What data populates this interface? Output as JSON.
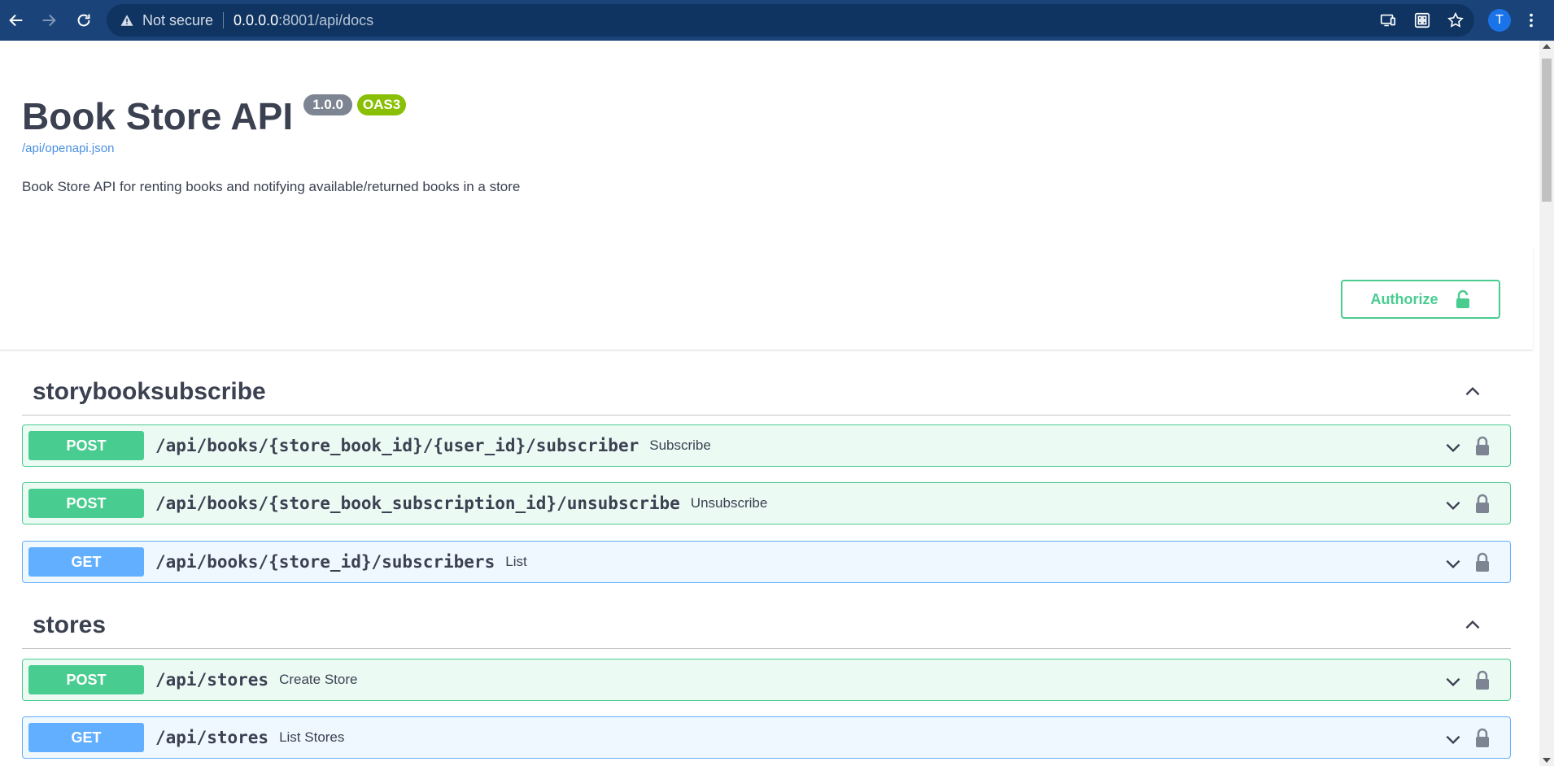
{
  "browser": {
    "not_secure": "Not secure",
    "url_host": "0.0.0.0",
    "url_rest": ":8001/api/docs",
    "profile_initial": "T"
  },
  "info": {
    "title": "Book Store API",
    "version": "1.0.0",
    "oas": "OAS3",
    "spec_link": "/api/openapi.json",
    "description": "Book Store API for renting books and notifying available/returned books in a store"
  },
  "authorize_label": "Authorize",
  "tags": [
    {
      "name": "storybooksubscribe",
      "operations": [
        {
          "method": "POST",
          "path": "/api/books/{store_book_id}/{user_id}/subscriber",
          "summary": "Subscribe"
        },
        {
          "method": "POST",
          "path": "/api/books/{store_book_subscription_id}/unsubscribe",
          "summary": "Unsubscribe"
        },
        {
          "method": "GET",
          "path": "/api/books/{store_id}/subscribers",
          "summary": "List"
        }
      ]
    },
    {
      "name": "stores",
      "operations": [
        {
          "method": "POST",
          "path": "/api/stores",
          "summary": "Create Store"
        },
        {
          "method": "GET",
          "path": "/api/stores",
          "summary": "List Stores"
        }
      ]
    }
  ],
  "colors": {
    "post": "#49cc90",
    "get": "#61affe",
    "browser_bar": "#1a4479",
    "version_badge": "#7d8492",
    "oas_badge": "#89bf04"
  }
}
